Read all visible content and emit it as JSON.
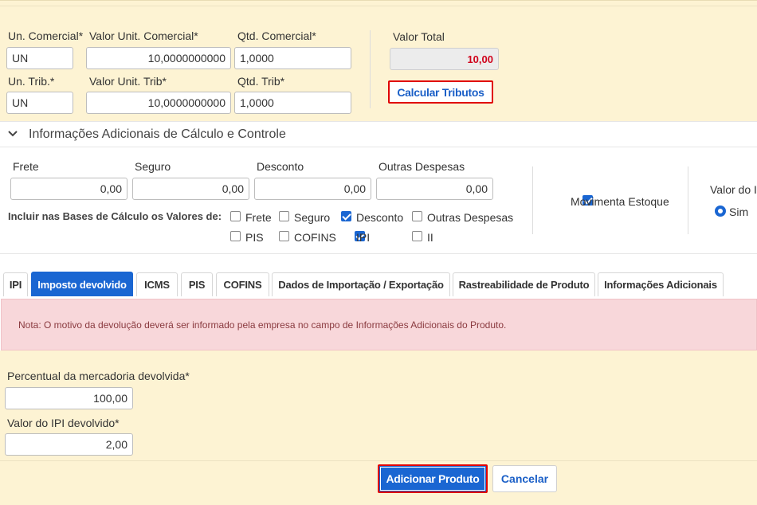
{
  "commercial": {
    "un_label": "Un. Comercial*",
    "un_value": "UN",
    "valor_unit_label": "Valor Unit. Comercial*",
    "valor_unit_value": "10,0000000000",
    "qtd_label": "Qtd. Comercial*",
    "qtd_value": "1,0000"
  },
  "trib": {
    "un_label": "Un. Trib.*",
    "un_value": "UN",
    "valor_unit_label": "Valor Unit. Trib*",
    "valor_unit_value": "10,0000000000",
    "qtd_label": "Qtd. Trib*",
    "qtd_value": "1,0000"
  },
  "total": {
    "label": "Valor Total",
    "value": "10,00",
    "value_color": "#d0021b"
  },
  "calc_button": "Calcular Tributos",
  "section": {
    "title": "Informações Adicionais de Cálculo e Controle",
    "icon": "chevron-down-icon"
  },
  "extras": {
    "frete_label": "Frete",
    "frete_value": "0,00",
    "seguro_label": "Seguro",
    "seguro_value": "0,00",
    "desconto_label": "Desconto",
    "desconto_value": "0,00",
    "outras_label": "Outras Despesas",
    "outras_value": "0,00"
  },
  "bases": {
    "label": "Incluir nas Bases de Cálculo os Valores de:",
    "options": [
      {
        "label": "Frete",
        "checked": false
      },
      {
        "label": "Seguro",
        "checked": false
      },
      {
        "label": "Desconto",
        "checked": true
      },
      {
        "label": "Outras Despesas",
        "checked": false
      },
      {
        "label": "PIS",
        "checked": false
      },
      {
        "label": "COFINS",
        "checked": false
      },
      {
        "label": "IPI",
        "checked": true
      },
      {
        "label": "II",
        "checked": false
      }
    ]
  },
  "movimenta": {
    "label": "Movimenta Estoque",
    "checked": true
  },
  "valor_i": {
    "label": "Valor do I",
    "radio_label": "Sim"
  },
  "tabs": [
    {
      "label": "IPI",
      "active": false
    },
    {
      "label": "Imposto devolvido",
      "active": true
    },
    {
      "label": "ICMS",
      "active": false
    },
    {
      "label": "PIS",
      "active": false
    },
    {
      "label": "COFINS",
      "active": false
    },
    {
      "label": "Dados de Importação / Exportação",
      "active": false
    },
    {
      "label": "Rastreabilidade de Produto",
      "active": false
    },
    {
      "label": "Informações Adicionais",
      "active": false
    }
  ],
  "note": "Nota: O motivo da devolução deverá ser informado pela empresa no campo de Informações Adicionais do Produto.",
  "devolvido": {
    "percentual_label": "Percentual da mercadoria devolvida*",
    "percentual_value": "100,00",
    "ipi_label": "Valor do IPI devolvido*",
    "ipi_value": "2,00"
  },
  "footer": {
    "add_label": "Adicionar Produto",
    "cancel_label": "Cancelar"
  },
  "colors": {
    "primary": "#1a66d2",
    "highlight_border": "#e00000",
    "panel_bg": "#fdf3d3",
    "alert_bg": "#f8d7da"
  }
}
